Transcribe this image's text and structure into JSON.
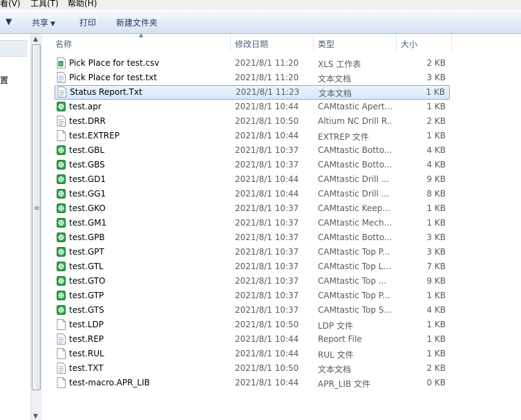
{
  "menu": {
    "view": "看(V)",
    "tools": "工具(T)",
    "help": "帮助(H)"
  },
  "toolbar": {
    "share": "共享",
    "print": "打印",
    "new_folder": "新建文件夹"
  },
  "nav": {
    "partial_label": "置"
  },
  "columns": {
    "name": "名称",
    "date": "修改日期",
    "type": "类型",
    "size": "大小"
  },
  "files": [
    {
      "name": "Pick Place for test.csv",
      "date": "2021/8/1 11:20",
      "type": "XLS 工作表",
      "size": "2 KB",
      "icon": "spreadsheet-icon"
    },
    {
      "name": "Pick Place for test.txt",
      "date": "2021/8/1 11:20",
      "type": "文本文档",
      "size": "3 KB",
      "icon": "text-file-icon"
    },
    {
      "name": "Status Report.Txt",
      "date": "2021/8/1 11:23",
      "type": "文本文档",
      "size": "1 KB",
      "icon": "text-file-icon",
      "selected": true
    },
    {
      "name": "test.apr",
      "date": "2021/8/1 10:44",
      "type": "CAMtastic Apert...",
      "size": "1 KB",
      "icon": "camtastic-icon"
    },
    {
      "name": "test.DRR",
      "date": "2021/8/1 10:50",
      "type": "Altium NC Drill R...",
      "size": "2 KB",
      "icon": "text-file-icon"
    },
    {
      "name": "test.EXTREP",
      "date": "2021/8/1 10:44",
      "type": "EXTREP 文件",
      "size": "1 KB",
      "icon": "blank-file-icon"
    },
    {
      "name": "test.GBL",
      "date": "2021/8/1 10:37",
      "type": "CAMtastic Botto...",
      "size": "4 KB",
      "icon": "camtastic-icon"
    },
    {
      "name": "test.GBS",
      "date": "2021/8/1 10:37",
      "type": "CAMtastic Botto...",
      "size": "4 KB",
      "icon": "camtastic-icon"
    },
    {
      "name": "test.GD1",
      "date": "2021/8/1 10:44",
      "type": "CAMtastic Drill ...",
      "size": "9 KB",
      "icon": "camtastic-icon"
    },
    {
      "name": "test.GG1",
      "date": "2021/8/1 10:44",
      "type": "CAMtastic Drill ...",
      "size": "8 KB",
      "icon": "camtastic-icon"
    },
    {
      "name": "test.GKO",
      "date": "2021/8/1 10:37",
      "type": "CAMtastic Keep...",
      "size": "1 KB",
      "icon": "camtastic-icon"
    },
    {
      "name": "test.GM1",
      "date": "2021/8/1 10:37",
      "type": "CAMtastic Mech...",
      "size": "1 KB",
      "icon": "camtastic-icon"
    },
    {
      "name": "test.GPB",
      "date": "2021/8/1 10:37",
      "type": "CAMtastic Botto...",
      "size": "3 KB",
      "icon": "camtastic-icon"
    },
    {
      "name": "test.GPT",
      "date": "2021/8/1 10:37",
      "type": "CAMtastic Top P...",
      "size": "3 KB",
      "icon": "camtastic-icon"
    },
    {
      "name": "test.GTL",
      "date": "2021/8/1 10:37",
      "type": "CAMtastic Top L...",
      "size": "7 KB",
      "icon": "camtastic-icon"
    },
    {
      "name": "test.GTO",
      "date": "2021/8/1 10:37",
      "type": "CAMtastic Top ...",
      "size": "9 KB",
      "icon": "camtastic-icon"
    },
    {
      "name": "test.GTP",
      "date": "2021/8/1 10:37",
      "type": "CAMtastic Top P...",
      "size": "1 KB",
      "icon": "camtastic-icon"
    },
    {
      "name": "test.GTS",
      "date": "2021/8/1 10:37",
      "type": "CAMtastic Top S...",
      "size": "4 KB",
      "icon": "camtastic-icon"
    },
    {
      "name": "test.LDP",
      "date": "2021/8/1 10:50",
      "type": "LDP 文件",
      "size": "1 KB",
      "icon": "blank-file-icon"
    },
    {
      "name": "test.REP",
      "date": "2021/8/1 10:44",
      "type": "Report File",
      "size": "1 KB",
      "icon": "text-file-icon"
    },
    {
      "name": "test.RUL",
      "date": "2021/8/1 10:44",
      "type": "RUL 文件",
      "size": "1 KB",
      "icon": "blank-file-icon"
    },
    {
      "name": "test.TXT",
      "date": "2021/8/1 10:50",
      "type": "文本文档",
      "size": "2 KB",
      "icon": "text-file-icon"
    },
    {
      "name": "test-macro.APR_LIB",
      "date": "2021/8/1 10:44",
      "type": "APR_LIB 文件",
      "size": "0 KB",
      "icon": "blank-file-icon"
    }
  ]
}
